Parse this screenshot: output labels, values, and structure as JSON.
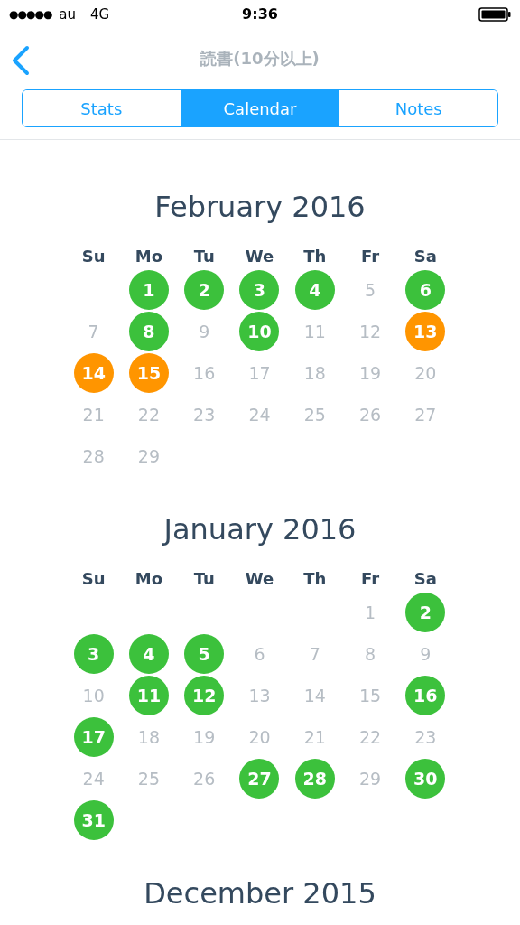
{
  "status_bar": {
    "signal": "●●●●●",
    "carrier": "au",
    "network": "4G",
    "time": "9:36"
  },
  "nav": {
    "title": "読書(10分以上)"
  },
  "tabs": [
    {
      "label": "Stats",
      "selected": false
    },
    {
      "label": "Calendar",
      "selected": true
    },
    {
      "label": "Notes",
      "selected": false
    }
  ],
  "months": [
    {
      "title": "February 2016",
      "weekdays": [
        "Su",
        "Mo",
        "Tu",
        "We",
        "Th",
        "Fr",
        "Sa"
      ],
      "weeks": [
        [
          {
            "kind": "blank"
          },
          {
            "kind": "day",
            "day": "1",
            "color": "#3cc13c"
          },
          {
            "kind": "day",
            "day": "2",
            "color": "#3cc13c"
          },
          {
            "kind": "day",
            "day": "3",
            "color": "#3cc13c"
          },
          {
            "kind": "day",
            "day": "4",
            "color": "#3cc13c"
          },
          {
            "kind": "day",
            "day": "5"
          },
          {
            "kind": "day",
            "day": "6",
            "color": "#3cc13c"
          }
        ],
        [
          {
            "kind": "day",
            "day": "7"
          },
          {
            "kind": "day",
            "day": "8",
            "color": "#3cc13c"
          },
          {
            "kind": "day",
            "day": "9"
          },
          {
            "kind": "day",
            "day": "10",
            "color": "#3cc13c"
          },
          {
            "kind": "day",
            "day": "11"
          },
          {
            "kind": "day",
            "day": "12"
          },
          {
            "kind": "day",
            "day": "13",
            "color": "#ff9500"
          }
        ],
        [
          {
            "kind": "day",
            "day": "14",
            "color": "#ff9500"
          },
          {
            "kind": "day",
            "day": "15",
            "color": "#ff9500"
          },
          {
            "kind": "day",
            "day": "16"
          },
          {
            "kind": "day",
            "day": "17"
          },
          {
            "kind": "day",
            "day": "18"
          },
          {
            "kind": "day",
            "day": "19"
          },
          {
            "kind": "day",
            "day": "20"
          }
        ],
        [
          {
            "kind": "day",
            "day": "21"
          },
          {
            "kind": "day",
            "day": "22"
          },
          {
            "kind": "day",
            "day": "23"
          },
          {
            "kind": "day",
            "day": "24"
          },
          {
            "kind": "day",
            "day": "25"
          },
          {
            "kind": "day",
            "day": "26"
          },
          {
            "kind": "day",
            "day": "27"
          }
        ],
        [
          {
            "kind": "day",
            "day": "28"
          },
          {
            "kind": "day",
            "day": "29"
          }
        ]
      ]
    },
    {
      "title": "January 2016",
      "weekdays": [
        "Su",
        "Mo",
        "Tu",
        "We",
        "Th",
        "Fr",
        "Sa"
      ],
      "weeks": [
        [
          {
            "kind": "blank"
          },
          {
            "kind": "blank"
          },
          {
            "kind": "blank"
          },
          {
            "kind": "blank"
          },
          {
            "kind": "blank"
          },
          {
            "kind": "day",
            "day": "1"
          },
          {
            "kind": "day",
            "day": "2",
            "color": "#3cc13c"
          }
        ],
        [
          {
            "kind": "day",
            "day": "3",
            "color": "#3cc13c"
          },
          {
            "kind": "day",
            "day": "4",
            "color": "#3cc13c"
          },
          {
            "kind": "day",
            "day": "5",
            "color": "#3cc13c"
          },
          {
            "kind": "day",
            "day": "6"
          },
          {
            "kind": "day",
            "day": "7"
          },
          {
            "kind": "day",
            "day": "8"
          },
          {
            "kind": "day",
            "day": "9"
          }
        ],
        [
          {
            "kind": "day",
            "day": "10"
          },
          {
            "kind": "day",
            "day": "11",
            "color": "#3cc13c"
          },
          {
            "kind": "day",
            "day": "12",
            "color": "#3cc13c"
          },
          {
            "kind": "day",
            "day": "13"
          },
          {
            "kind": "day",
            "day": "14"
          },
          {
            "kind": "day",
            "day": "15"
          },
          {
            "kind": "day",
            "day": "16",
            "color": "#3cc13c"
          }
        ],
        [
          {
            "kind": "day",
            "day": "17",
            "color": "#3cc13c"
          },
          {
            "kind": "day",
            "day": "18"
          },
          {
            "kind": "day",
            "day": "19"
          },
          {
            "kind": "day",
            "day": "20"
          },
          {
            "kind": "day",
            "day": "21"
          },
          {
            "kind": "day",
            "day": "22"
          },
          {
            "kind": "day",
            "day": "23"
          }
        ],
        [
          {
            "kind": "day",
            "day": "24"
          },
          {
            "kind": "day",
            "day": "25"
          },
          {
            "kind": "day",
            "day": "26"
          },
          {
            "kind": "day",
            "day": "27",
            "color": "#3cc13c"
          },
          {
            "kind": "day",
            "day": "28",
            "color": "#3cc13c"
          },
          {
            "kind": "day",
            "day": "29"
          },
          {
            "kind": "day",
            "day": "30",
            "color": "#3cc13c"
          }
        ],
        [
          {
            "kind": "day",
            "day": "31",
            "color": "#3cc13c"
          }
        ]
      ]
    },
    {
      "title": "December 2015"
    }
  ]
}
